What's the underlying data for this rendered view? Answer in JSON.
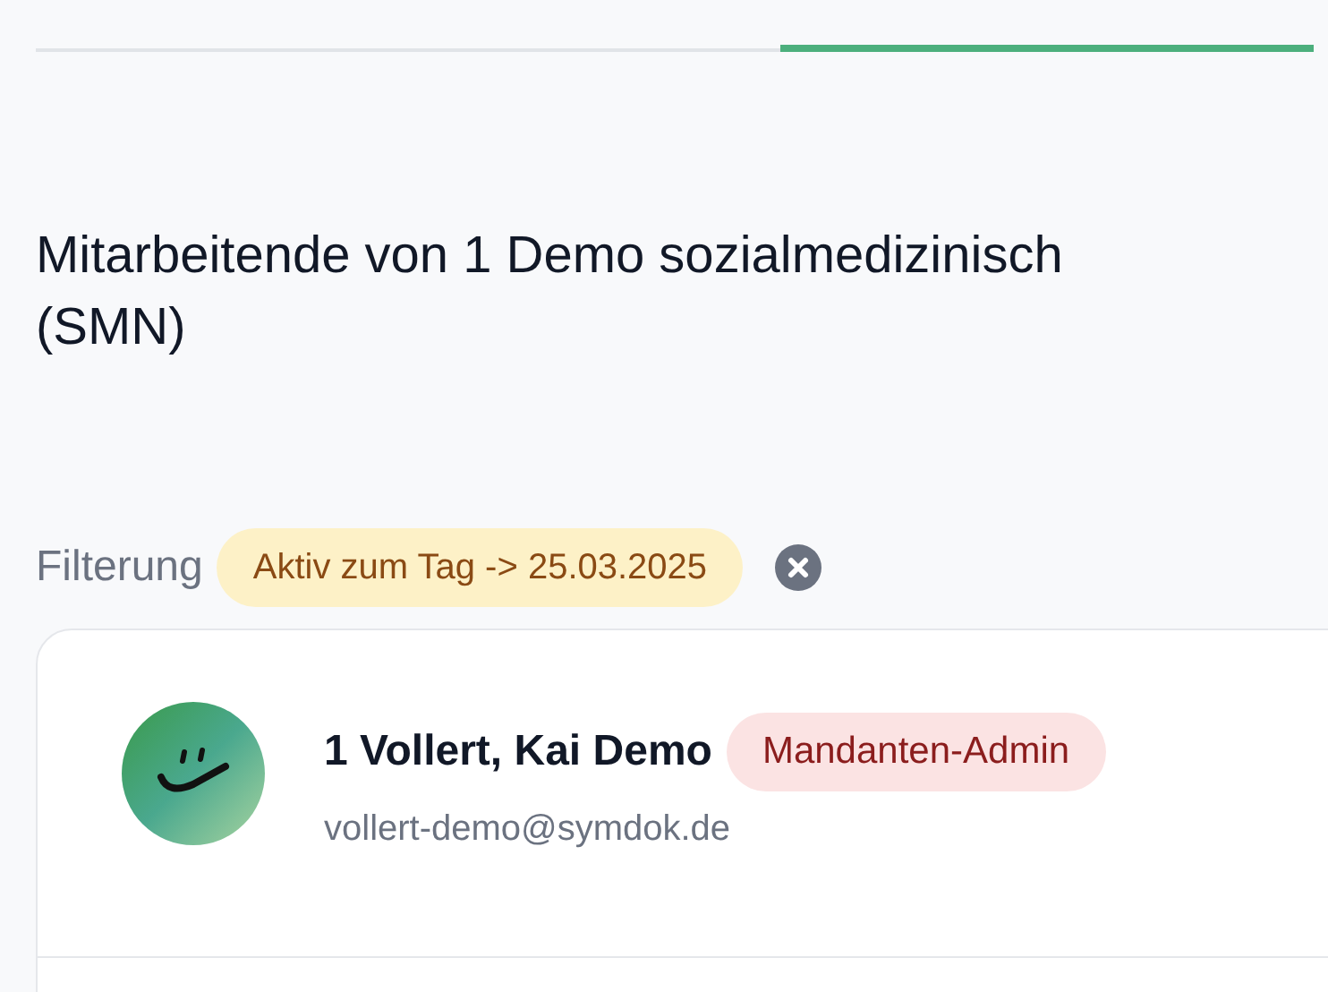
{
  "tabs": [
    {
      "selected": false
    },
    {
      "selected": true
    }
  ],
  "title_lines": [
    "Mitarbeitende von 1 Demo sozialmedizinisch",
    "(SMN)"
  ],
  "filter": {
    "label": "Filterung",
    "chips": [
      {
        "text": "Aktiv zum Tag -> 25.03.2025"
      }
    ]
  },
  "employees": [
    {
      "name": "1 Vollert, Kai Demo",
      "role": "Mandanten-Admin",
      "email": "vollert-demo@symdok.de"
    }
  ]
}
